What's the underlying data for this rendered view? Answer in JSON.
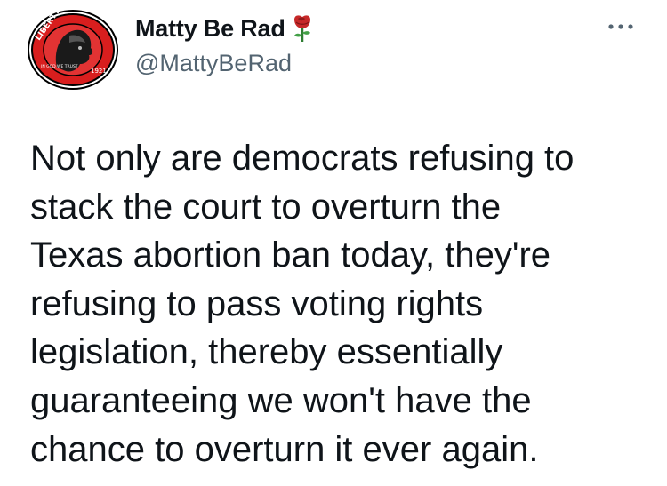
{
  "tweet": {
    "author": {
      "display_name": "Matty Be Rad",
      "handle": "@MattyBeRad",
      "name_emoji": "rose-emoji",
      "avatar": {
        "ring_text": "LIBERTY",
        "year_text": "1921",
        "motto_text": "IN GOD WE TRUST",
        "colors": {
          "ring": "#d81e1e",
          "face": "#1a1a1a"
        }
      }
    },
    "more_icon": "more-horizontal-icon",
    "text": "Not only are democrats refusing to\nstack the court to overturn the\nTexas abortion ban today, they're\nrefusing to pass voting rights\nlegislation, thereby essentially\nguaranteeing we won't have the\nchance to overturn it ever again."
  }
}
